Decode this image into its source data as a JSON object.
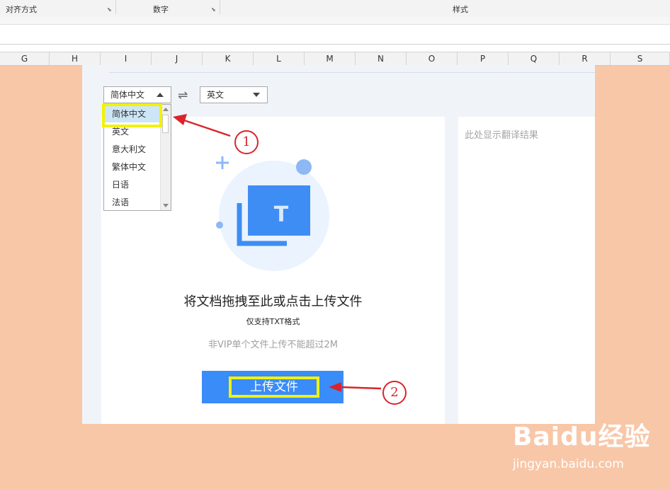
{
  "ribbon": {
    "alignment_label": "对齐方式",
    "number_label": "数字",
    "style_label": "样式"
  },
  "columns": [
    "G",
    "H",
    "I",
    "J",
    "K",
    "L",
    "M",
    "N",
    "O",
    "P",
    "Q",
    "R",
    "S"
  ],
  "translator": {
    "source_language": "简体中文",
    "target_language": "英文",
    "language_options": [
      "简体中文",
      "英文",
      "意大利文",
      "繁体中文",
      "日语",
      "法语"
    ],
    "drop_title": "将文档拖拽至此或点击上传文件",
    "format_note": "仅支持TXT格式",
    "limit_note": "非VIP单个文件上传不能超过2M",
    "upload_button": "上传文件",
    "result_placeholder": "此处显示翻译结果",
    "icon_letter": "T"
  },
  "annotations": {
    "step1": "1",
    "step2": "2"
  },
  "watermark": {
    "logo": "Baidu经验",
    "url": "jingyan.baidu.com"
  },
  "colors": {
    "accent_blue": "#3a8cf8",
    "highlight_yellow": "#f2f200",
    "annotation_red": "#d9252a",
    "page_background": "#f8c7a8"
  }
}
